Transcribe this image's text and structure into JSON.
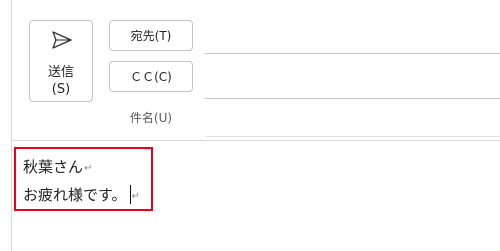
{
  "compose": {
    "send_button": {
      "label": "送信",
      "shortcut": "(S)",
      "icon": "paper-plane-icon"
    },
    "to_button_label": "宛先(T)",
    "cc_button_label": "ＣＣ(C)",
    "subject_label": "件名(U)",
    "to_value": "",
    "cc_value": "",
    "subject_value": ""
  },
  "body": {
    "lines": [
      "秋葉さん",
      "お疲れ様です。"
    ],
    "paragraph_mark": "↵",
    "highlight_color": "#e8001c"
  }
}
